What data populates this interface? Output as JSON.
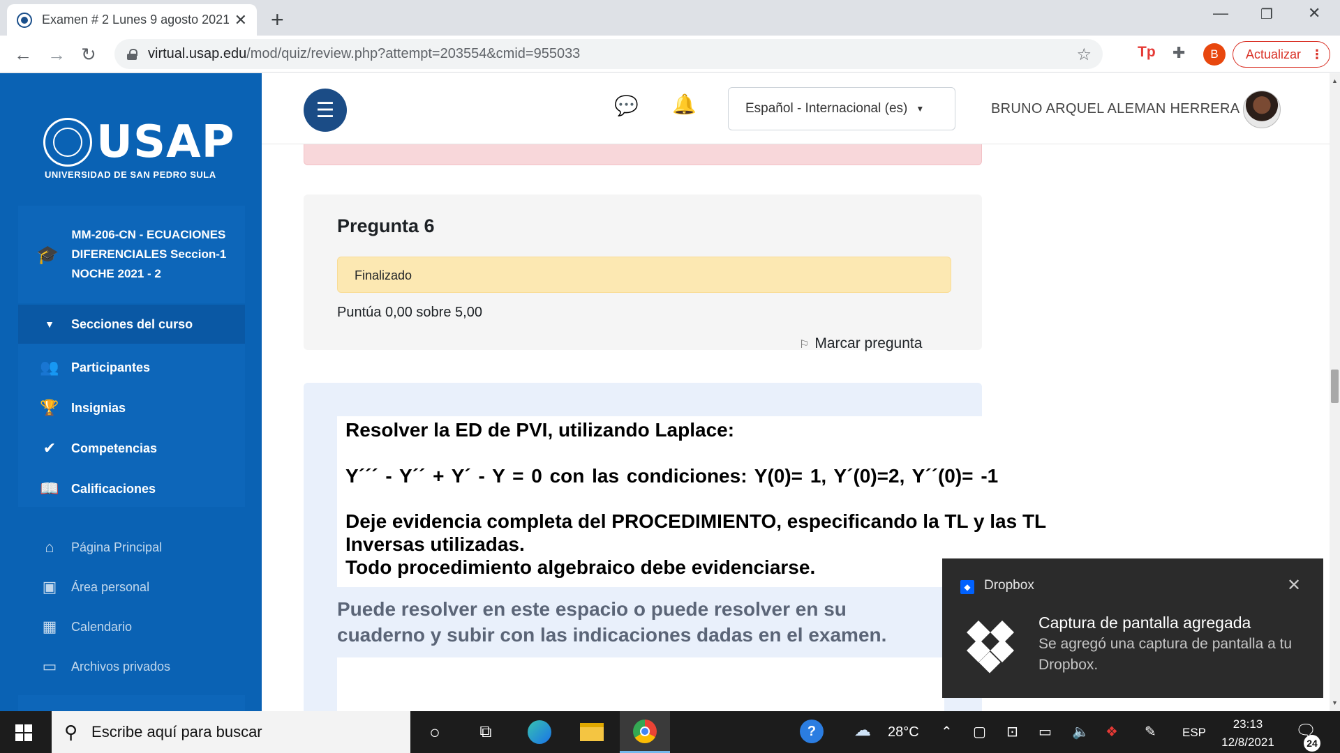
{
  "browser": {
    "tab_title": "Examen # 2 Lunes 9 agosto 2021",
    "tab_close": "✕",
    "new_tab": "+",
    "url_host": "virtual.usap.edu",
    "url_rest": "/mod/quiz/review.php?attempt=203554&cmid=955033",
    "profile_initial": "B",
    "update_label": "Actualizar",
    "ext_tp": "Tp"
  },
  "sidebar": {
    "logo_word": "USAP",
    "logo_sub": "UNIVERSIDAD DE SAN PEDRO SULA",
    "course_name": "MM-206-CN - ECUACIONES DIFERENCIALES Seccion-1 NOCHE 2021 - 2",
    "items": [
      {
        "label": "Secciones del curso",
        "icon": "chevron-down-icon"
      },
      {
        "label": "Participantes",
        "icon": "users-icon"
      },
      {
        "label": "Insignias",
        "icon": "trophy-icon"
      },
      {
        "label": "Competencias",
        "icon": "check-icon"
      },
      {
        "label": "Calificaciones",
        "icon": "book-icon"
      }
    ],
    "site_items": [
      {
        "label": "Página Principal",
        "icon": "home-icon"
      },
      {
        "label": "Área personal",
        "icon": "dashboard-icon"
      },
      {
        "label": "Calendario",
        "icon": "calendar-icon"
      },
      {
        "label": "Archivos privados",
        "icon": "drive-icon"
      }
    ]
  },
  "header": {
    "language": "Español - Internacional (es)",
    "user_name": "BRUNO ARQUEL ALEMAN HERRERA"
  },
  "question": {
    "title": "Pregunta 6",
    "state": "Finalizado",
    "grade": "Puntúa 0,00 sobre 5,00",
    "flag_label": "Marcar pregunta",
    "line1": "Resolver la ED de PVI, utilizando Laplace:",
    "line2": "Y´´´ -   Y´´  +   Y´ -  Y  =  0  con las condiciones: Y(0)= 1, Y´(0)=2, Y´´(0)= -1",
    "line3a": "Deje evidencia completa del PROCEDIMIENTO, especificando la TL y las TL",
    "line3b": "Inversas utilizadas.",
    "line3c": "Todo procedimiento algebraico debe evidenciarse.",
    "note": "Puede resolver en este espacio o puede resolver en su cuaderno y subir con las indicaciones dadas en el examen."
  },
  "toast": {
    "app": "Dropbox",
    "heading": "Captura de pantalla agregada",
    "body": "Se agregó una captura de pantalla a tu Dropbox."
  },
  "taskbar": {
    "search_placeholder": "Escribe aquí para buscar",
    "weather": "28°C",
    "language": "ESP",
    "time": "23:13",
    "date": "12/8/2021",
    "notifications": "24"
  }
}
